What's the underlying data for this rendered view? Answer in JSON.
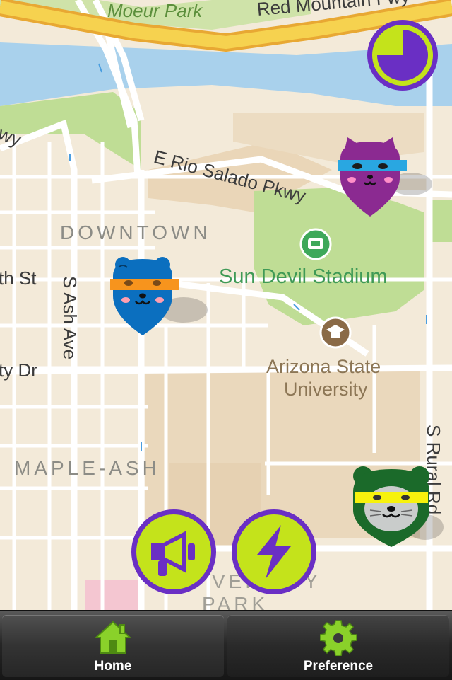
{
  "map": {
    "labels": {
      "park": "Moeur Park",
      "fwy": "Red Mountain Fwy",
      "wy": "wy",
      "rio": "E Rio Salado Pkwy",
      "downtown": "DOWNTOWN",
      "stadium": "Sun Devil Stadium",
      "th_st": "th St",
      "ash": "S Ash Ave",
      "ty_dr": "ty Dr",
      "asu_1": "Arizona State",
      "asu_2": "University",
      "maple": "MAPLE-ASH",
      "rural": "S Rural Rd",
      "park_district_1": "VERSITY",
      "park_district_2": "PARK"
    },
    "colors": {
      "land": "#f3ead9",
      "water": "#a9d1ec",
      "green": "#bfdd95",
      "highway": "#f6c64a",
      "road": "#ffffff"
    }
  },
  "markers": [
    {
      "name": "bear-blue",
      "color": "#0b6fbf",
      "band": "#f7941d"
    },
    {
      "name": "cat-purple",
      "color": "#8b2a91",
      "band": "#29a7e1"
    },
    {
      "name": "otter-green",
      "color": "#1b6a2a",
      "band": "#f7f20d"
    }
  ],
  "actions": {
    "timer_icon": "timer-pie-icon",
    "announce_icon": "megaphone-icon",
    "power_icon": "lightning-icon",
    "accent": "#6a2fc4",
    "fill": "#c4e31b"
  },
  "tabbar": {
    "home_label": "Home",
    "home_icon": "house-icon",
    "pref_label": "Preference",
    "pref_icon": "gear-icon"
  }
}
